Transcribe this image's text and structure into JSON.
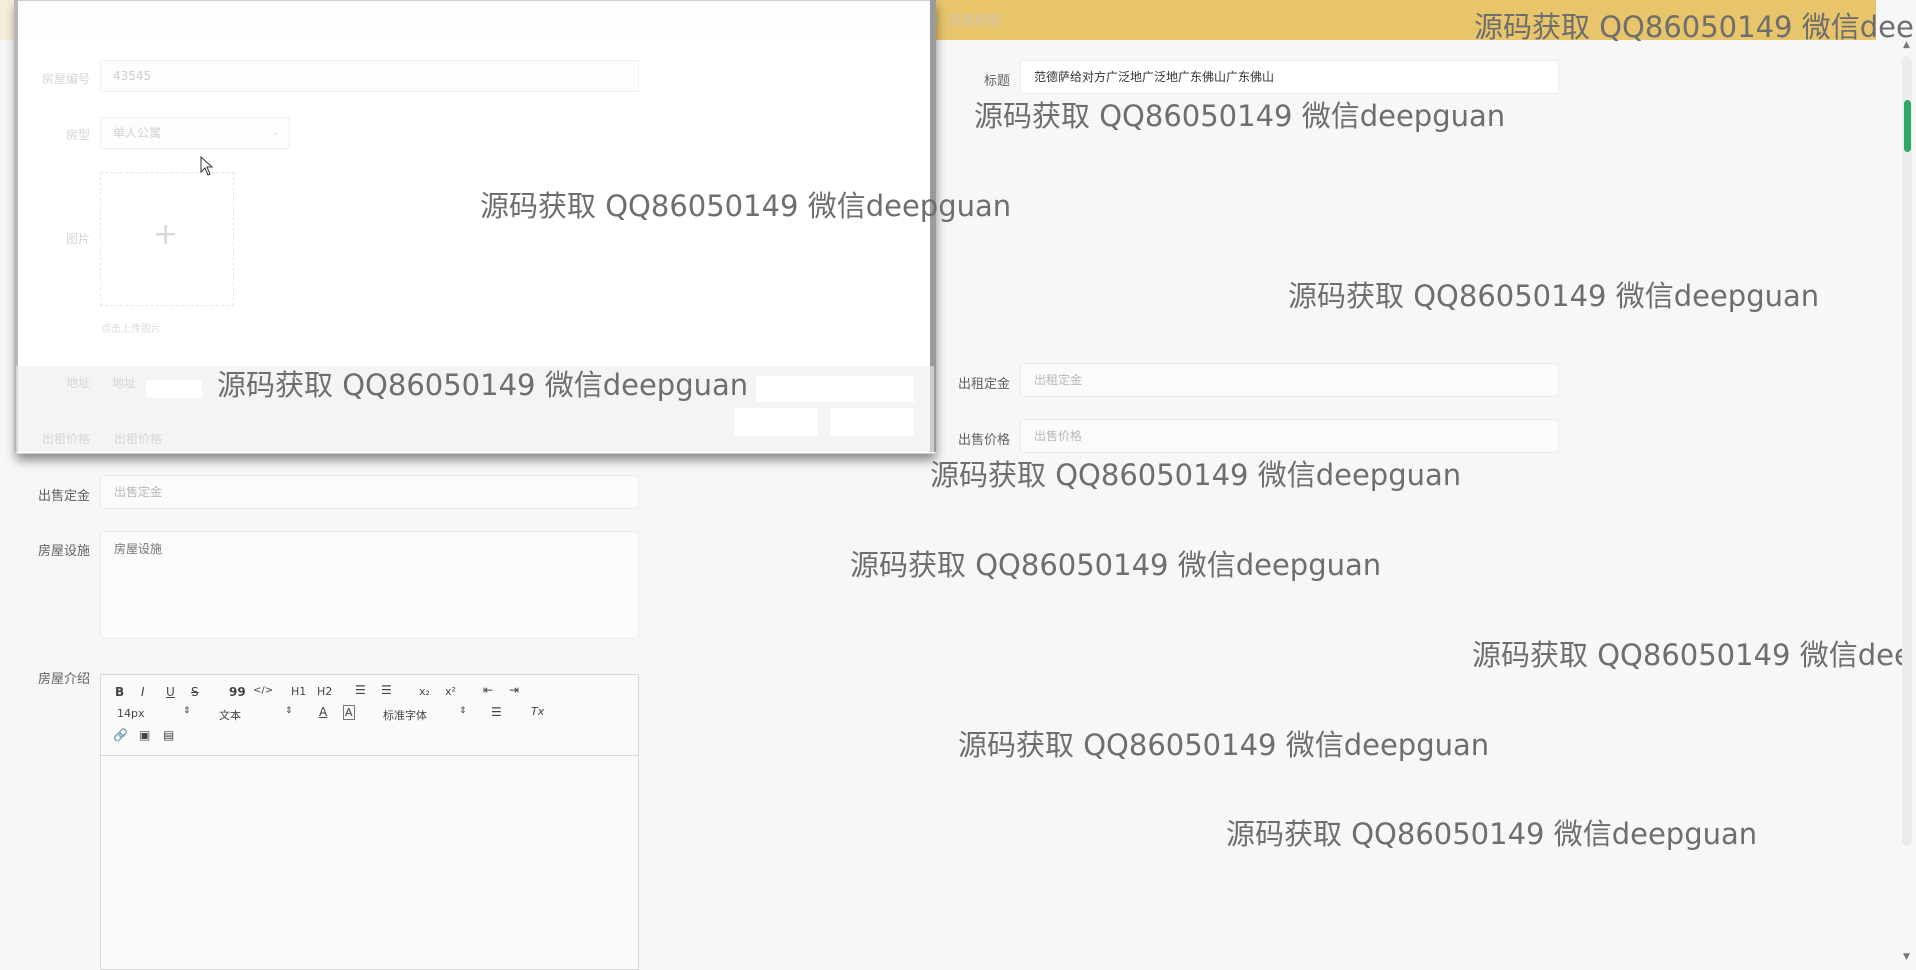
{
  "breadcrumb": {
    "home": "首页",
    "separator": "/",
    "current": "房屋租售"
  },
  "form": {
    "house_no_label": "房屋编号",
    "house_no_value": "43545",
    "title_label": "标题",
    "title_value": "范德萨给对方广泛地广泛地广东佛山广东佛山",
    "house_type_label": "房型",
    "house_type_value": "单人公寓",
    "image_label": "图片",
    "upload_hint": "点击上传图片",
    "address_label": "地址",
    "address_placeholder": "地址",
    "rent_deposit_label": "出租定金",
    "rent_deposit_placeholder": "出租定金",
    "rent_price_label": "出租价格",
    "rent_price_placeholder": "出租价格",
    "sale_price_label": "出售价格",
    "sale_price_placeholder": "出售价格",
    "sale_deposit_label": "出售定金",
    "sale_deposit_placeholder": "出售定金",
    "facilities_label": "房屋设施",
    "facilities_placeholder": "房屋设施",
    "intro_label": "房屋介绍"
  },
  "editor": {
    "font_size": "14px",
    "text_type": "文本",
    "font_family": "标准字体",
    "bold": "B",
    "italic": "I",
    "underline": "U",
    "strike": "S",
    "quote": "99",
    "code": "</>",
    "h1": "H1",
    "h2": "H2",
    "subscript": "x₂",
    "superscript": "x²",
    "font_color": "A",
    "clear_format": "Tx"
  },
  "watermark": "源码获取 QQ86050149 微信deepguan",
  "watermark_cut": "源码获取 QQ86050149 微信dee",
  "colors": {
    "topbar": "#e8c46b",
    "scroll_thumb": "#2fa86a"
  },
  "icons": [
    "plus-icon",
    "cursor-icon",
    "link-icon",
    "image-icon",
    "video-icon",
    "ordered-list-icon",
    "bullet-list-icon",
    "indent-icon",
    "outdent-icon",
    "align-icon"
  ]
}
